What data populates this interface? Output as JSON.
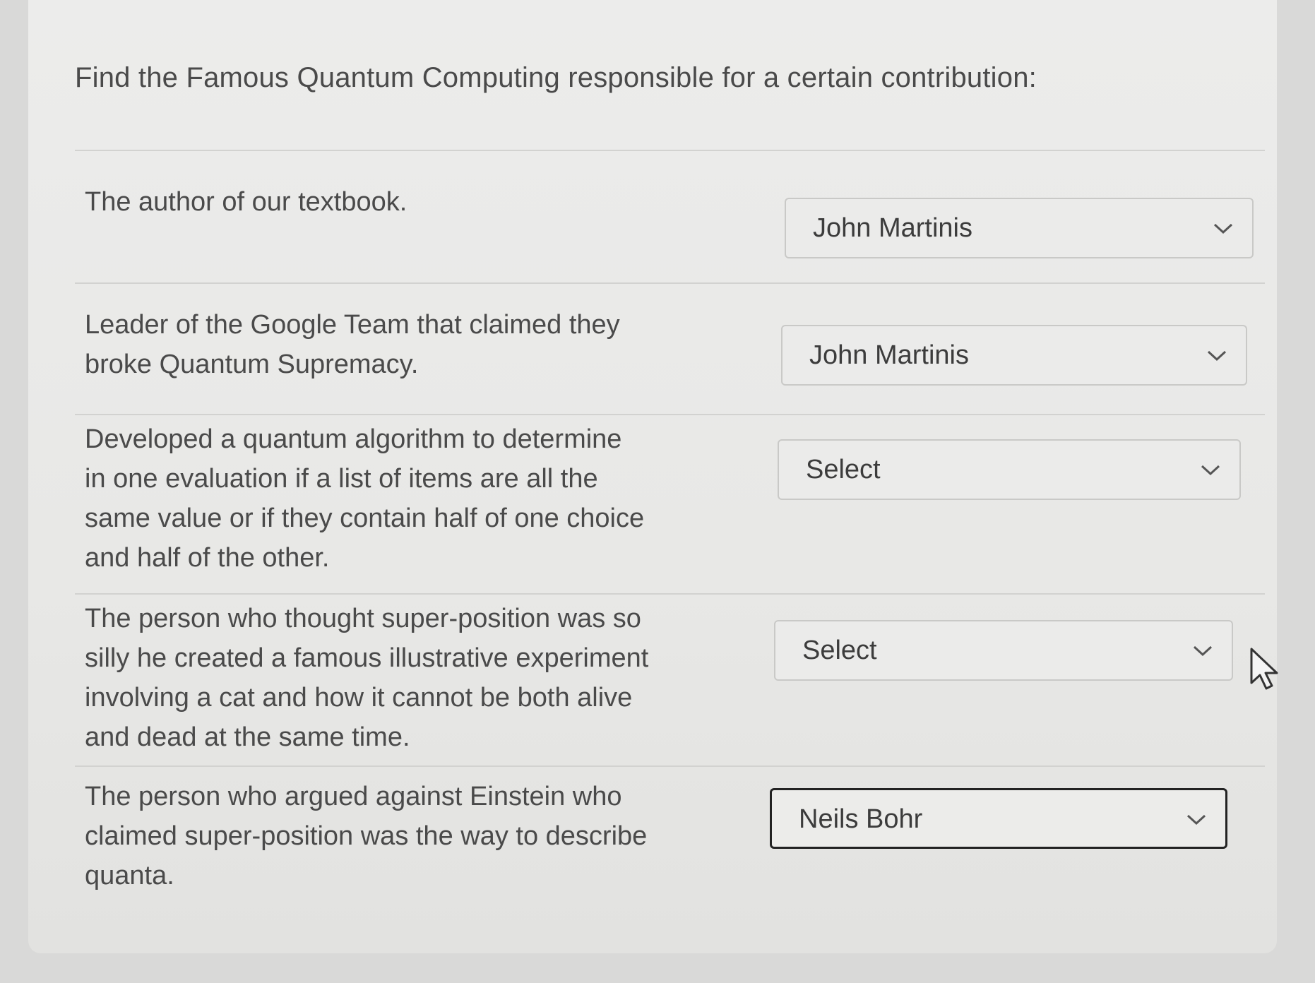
{
  "question": {
    "title": "Find the Famous Quantum Computing responsible for a certain contribution:"
  },
  "items": [
    {
      "prompt": "The author of our textbook.",
      "selected": "John Martinis"
    },
    {
      "prompt": "Leader of the Google Team that claimed they broke Quantum Supremacy.",
      "selected": "John Martinis"
    },
    {
      "prompt": "Developed a quantum algorithm to determine in one evaluation if a list of items are all the same value or if they contain half of one choice and half of the other.",
      "selected": "Select"
    },
    {
      "prompt": "The person who thought super-position was so silly he created a famous illustrative experiment involving a cat and how it cannot be both alive and dead at the same time.",
      "selected": "Select"
    },
    {
      "prompt": "The person who argued against Einstein who claimed super-position was the way to describe quanta.",
      "selected": "Neils Bohr"
    }
  ],
  "icons": {
    "dropdown": "chevron-down-icon",
    "pointer": "mouse-cursor-icon"
  },
  "colors": {
    "text": "#4a4a4a",
    "focus_border": "#222222",
    "card_bg": "#ececeb"
  }
}
